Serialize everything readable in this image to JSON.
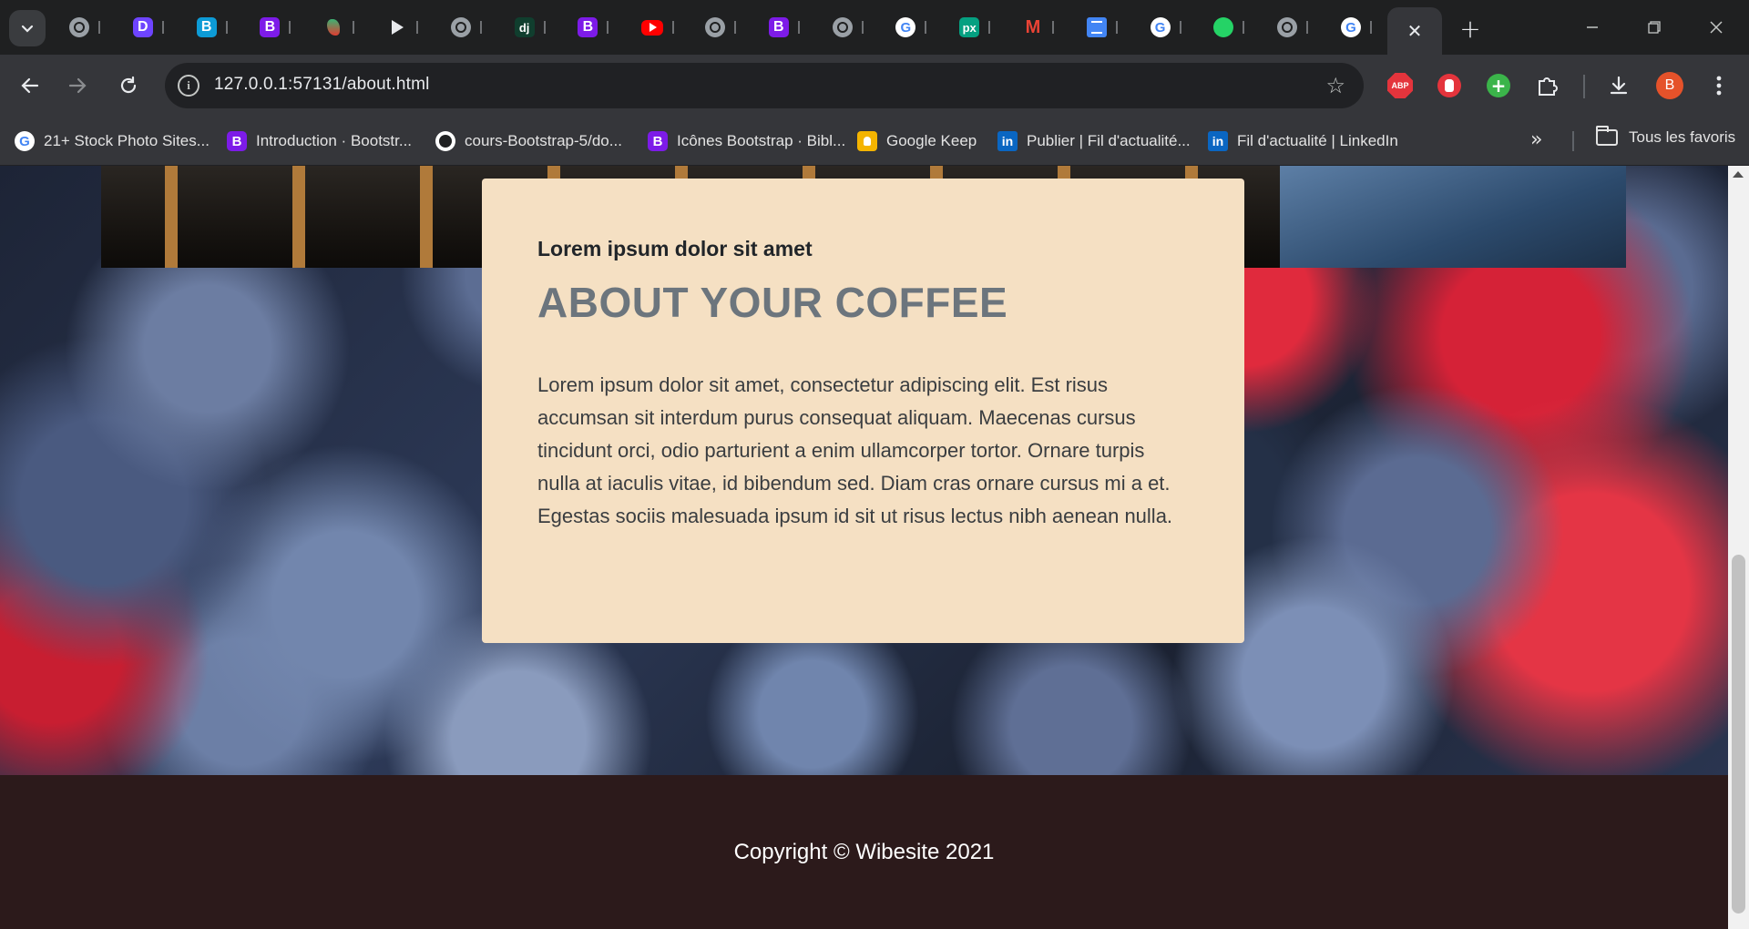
{
  "browser": {
    "tabs": [
      {
        "icon": "globe-icon"
      },
      {
        "icon": "duckduckgo-icon",
        "glyph": "D"
      },
      {
        "icon": "bootstrap-icon",
        "glyph": "B"
      },
      {
        "icon": "bootstrap-icon",
        "glyph": "B"
      },
      {
        "icon": "ua-icon"
      },
      {
        "icon": "play-icon"
      },
      {
        "icon": "globe-icon"
      },
      {
        "icon": "django-icon",
        "glyph": "dj"
      },
      {
        "icon": "bootstrap-icon",
        "glyph": "B"
      },
      {
        "icon": "youtube-icon"
      },
      {
        "icon": "globe-icon"
      },
      {
        "icon": "bootstrap-icon",
        "glyph": "B"
      },
      {
        "icon": "globe-icon"
      },
      {
        "icon": "google-icon",
        "glyph": "G"
      },
      {
        "icon": "pixabay-icon",
        "glyph": "px"
      },
      {
        "icon": "gmail-icon",
        "glyph": "M"
      },
      {
        "icon": "docs-icon"
      },
      {
        "icon": "google-icon",
        "glyph": "G"
      },
      {
        "icon": "whatsapp-icon"
      },
      {
        "icon": "globe-icon"
      },
      {
        "icon": "google-icon",
        "glyph": "G"
      }
    ],
    "active_tab_close": "✕",
    "new_tab": "+",
    "url": "127.0.0.1:57131/about.html",
    "avatar_initial": "B",
    "abp_label": "ABP",
    "bookmarks": [
      {
        "label": "21+ Stock Photo Sites...",
        "icon": "google-icon",
        "glyph": "G"
      },
      {
        "label": "Introduction · Bootstr...",
        "icon": "bootstrap-icon",
        "glyph": "B"
      },
      {
        "label": "cours-Bootstrap-5/do...",
        "icon": "github-icon",
        "glyph": ""
      },
      {
        "label": "Icônes Bootstrap · Bibl...",
        "icon": "bootstrap-icon",
        "glyph": "B"
      },
      {
        "label": "Google Keep",
        "icon": "keep-icon",
        "glyph": ""
      },
      {
        "label": "Publier | Fil d'actualité...",
        "icon": "linkedin-icon",
        "glyph": "in"
      },
      {
        "label": "Fil d'actualité | LinkedIn",
        "icon": "linkedin-icon",
        "glyph": "in"
      }
    ],
    "bookmarks_more": "»",
    "all_bookmarks": "Tous les favoris"
  },
  "page": {
    "about": {
      "kicker": "Lorem ipsum dolor sit amet",
      "heading": "ABOUT YOUR COFFEE",
      "body": "Lorem ipsum dolor sit amet, consectetur adipiscing elit. Est risus accumsan sit interdum purus consequat aliquam. Maecenas cursus tincidunt orci, odio parturient a enim ullamcorper tortor. Ornare turpis nulla at iaculis vitae, id bibendum sed. Diam cras ornare cursus mi a et. Egestas sociis malesuada ipsum id sit ut risus lectus nibh aenean nulla."
    },
    "footer": {
      "copyright": "Copyright © Wibesite 2021"
    }
  },
  "colors": {
    "card_background": "#f5e0c3",
    "footer_background": "#2c1a1b",
    "heading": "#6c757d"
  }
}
